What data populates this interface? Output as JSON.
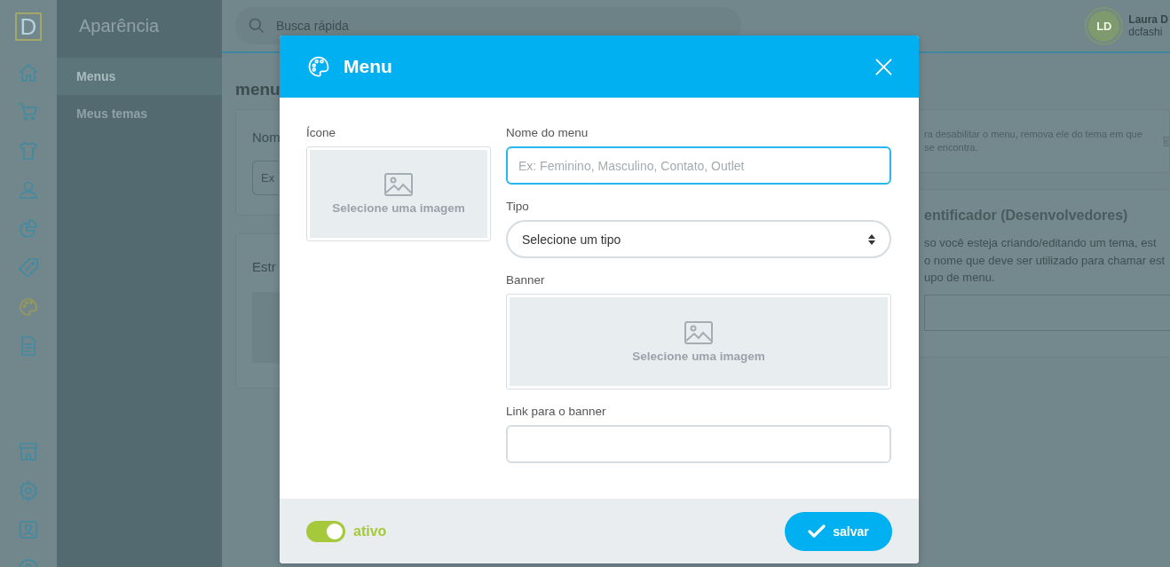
{
  "logo": "D",
  "nav": [
    {
      "kind": "home",
      "selected": false
    },
    {
      "kind": "cart",
      "selected": false
    },
    {
      "kind": "shirt",
      "selected": false
    },
    {
      "kind": "user",
      "selected": false
    },
    {
      "kind": "chart",
      "selected": false
    },
    {
      "kind": "tag",
      "selected": false
    },
    {
      "kind": "palette",
      "selected": true
    },
    {
      "kind": "document",
      "selected": false
    }
  ],
  "nav_bottom": [
    {
      "kind": "store"
    },
    {
      "kind": "settings"
    },
    {
      "kind": "contact"
    },
    {
      "kind": "help"
    }
  ],
  "sidebar": {
    "title": "Aparência",
    "items": [
      {
        "label": "Menus",
        "selected": true
      },
      {
        "label": "Meus temas",
        "selected": false
      }
    ]
  },
  "search": {
    "placeholder": "Busca rápida"
  },
  "user": {
    "initials": "LD",
    "name": "Laura D",
    "handle": "dcfashi"
  },
  "page": {
    "heading": "menu",
    "left_cards": [
      {
        "title": "Nom",
        "placeholder": "Ex"
      },
      {
        "title": "Estr"
      }
    ],
    "notice": {
      "lines": [
        "ra desabilitar o menu, remova ele do tema em que",
        "se encontra."
      ]
    },
    "identifier": {
      "title": "entificador (Desenvolvedores)",
      "lines": [
        "so você esteja criando/editando um tema, est",
        "o nome que deve ser utilizado para chamar est",
        "upo de menu."
      ]
    }
  },
  "modal": {
    "title": "Menu",
    "icon_picker": {
      "label": "Ícone",
      "text": "Selecione uma imagem"
    },
    "name_field": {
      "label": "Nome do menu",
      "placeholder": "Ex: Feminino, Masculino, Contato, Outlet",
      "focused": true
    },
    "type_select": {
      "label": "Tipo",
      "value": "Selecione um tipo"
    },
    "banner_picker": {
      "label": "Banner",
      "text": "Selecione uma imagem"
    },
    "link_field": {
      "label": "Link para o banner"
    },
    "toggle": {
      "label": "ativo",
      "on": true
    },
    "save_button": "salvar"
  }
}
